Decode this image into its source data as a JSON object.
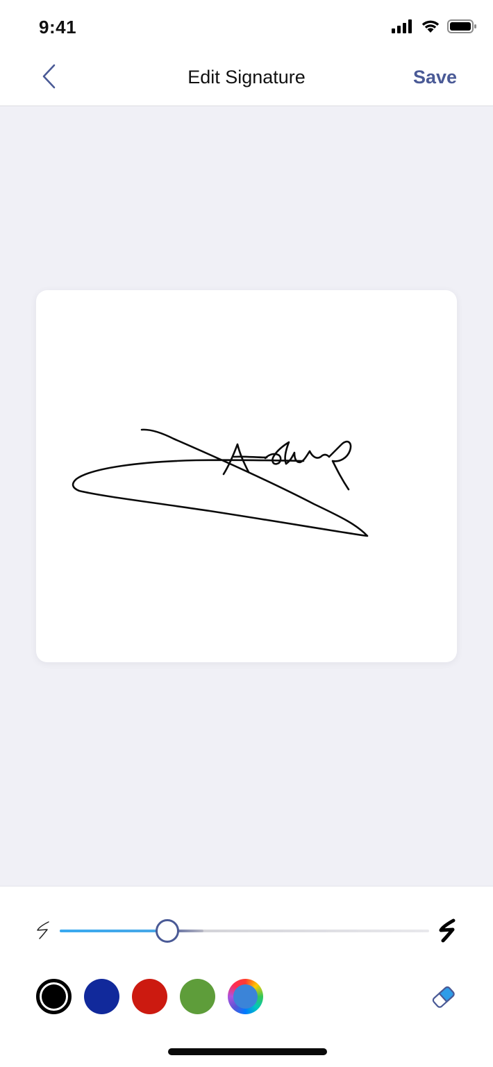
{
  "status_bar": {
    "time": "9:41"
  },
  "nav": {
    "title": "Edit Signature",
    "save_label": "Save"
  },
  "stroke_slider": {
    "value": 0.29
  },
  "colors": {
    "accent": "#4a5a96",
    "slider_fill": "#38a9f0",
    "swatches": [
      {
        "name": "black",
        "hex": "#000000",
        "selected": true
      },
      {
        "name": "blue",
        "hex": "#11299b",
        "selected": false
      },
      {
        "name": "red",
        "hex": "#cc1a10",
        "selected": false
      },
      {
        "name": "green",
        "hex": "#5e9d3a",
        "selected": false
      },
      {
        "name": "custom",
        "hex": "#3b84d8",
        "selected": false
      }
    ]
  },
  "icons": {
    "back": "chevron-left-icon",
    "thin_stroke": "thin-stroke-icon",
    "thick_stroke": "thick-stroke-icon",
    "eraser": "eraser-icon",
    "signal": "signal-icon",
    "wifi": "wifi-icon",
    "battery": "battery-icon"
  }
}
